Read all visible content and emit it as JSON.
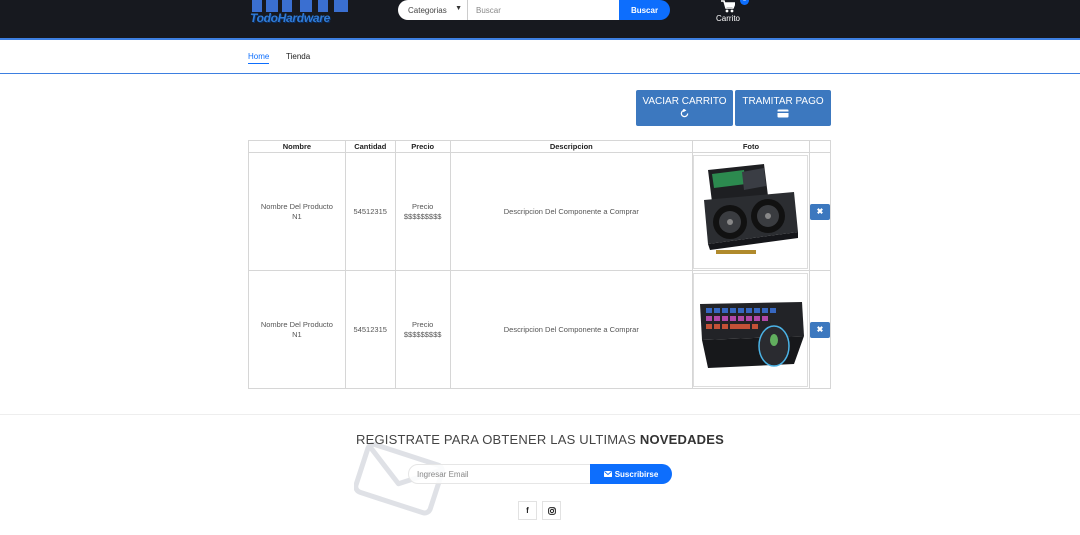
{
  "header": {
    "logo_text": "TodoHardware",
    "search": {
      "category_label": "Categorias",
      "placeholder": "Buscar",
      "button_label": "Buscar"
    },
    "cart": {
      "label": "Carrito",
      "count": "0"
    }
  },
  "nav": {
    "items": [
      {
        "label": "Home",
        "active": true
      },
      {
        "label": "Tienda",
        "active": false
      }
    ]
  },
  "actions": {
    "empty_cart": "VACIAR CARRITO",
    "checkout": "TRAMITAR PAGO"
  },
  "table": {
    "headers": [
      "Nombre",
      "Cantidad",
      "Precio",
      "Descripcion",
      "Foto",
      ""
    ],
    "rows": [
      {
        "name_line1": "Nombre Del Producto",
        "name_line2": "N1",
        "quantity": "54512315",
        "price_line1": "Precio",
        "price_line2": "$$$$$$$$$",
        "description": "Descripcion Del Componente a Comprar",
        "photo": "graphics-card",
        "delete_icon": "x-icon"
      },
      {
        "name_line1": "Nombre Del Producto",
        "name_line2": "N1",
        "quantity": "54512315",
        "price_line1": "Precio",
        "price_line2": "$$$$$$$$$",
        "description": "Descripcion Del Componente a Comprar",
        "photo": "keyboard-mouse",
        "delete_icon": "x-icon"
      }
    ]
  },
  "newsletter": {
    "title_prefix": "REGISTRATE PARA OBTENER LAS ULTIMAS",
    "title_bold": "NOVEDADES",
    "email_placeholder": "Ingresar Email",
    "subscribe_label": "Suscribirse"
  },
  "social": {
    "facebook": "f",
    "instagram": "instagram-icon"
  },
  "colors": {
    "header_bg": "#17191f",
    "accent": "#0d6efd",
    "action_button": "#3c78bf"
  }
}
